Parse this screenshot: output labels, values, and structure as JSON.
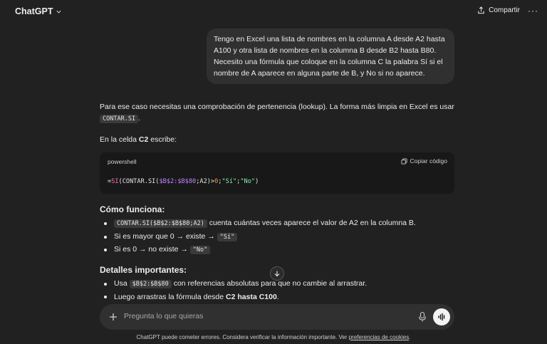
{
  "header": {
    "brand": "ChatGPT",
    "share_label": "Compartir",
    "more_label": "···"
  },
  "user_message": "Tengo en Excel una lista de nombres en la columna A desde A2 hasta A100 y otra lista de nombres en la columna B desde B2 hasta B80. Necesito una fórmula que coloque en la columna C la palabra Sí si el nombre de A aparece en alguna parte de B, y No si no aparece.",
  "answer": {
    "intro": "Para ese caso necesitas una comprobación de pertenencia (lookup). La forma más limpia en Excel es usar",
    "intro_code": "CONTAR.SI",
    "intro_end": ".",
    "cell_prefix": "En la celda ",
    "cell_bold": "C2",
    "cell_suffix": " escribe:",
    "code": {
      "lang": "powershell",
      "copy_label": "Copiar código",
      "t1": "=",
      "t2": "SI",
      "t3": "(CONTAR.SI(",
      "t4": "$B$2:$B$80",
      "t5": ";A2)>",
      "t6": "0",
      "t7": ";",
      "t8": "\"Sí\"",
      "t9": ";",
      "t10": "\"No\"",
      "t11": ")"
    },
    "how_title": "Cómo funciona:",
    "how_items": [
      {
        "code": "CONTAR.SI($B$2:$B$80;A2)",
        "text": " cuenta cuántas veces aparece el valor de A2 en la columna B."
      },
      {
        "text": "Si es mayor que 0 → existe → ",
        "code": "\"Sí\""
      },
      {
        "text": "Si es 0 → no existe → ",
        "code": "\"No\""
      }
    ],
    "details_title": "Detalles importantes:",
    "details_items": [
      {
        "pre": "Usa ",
        "code": "$B$2:$B$80",
        "text": " con referencias absolutas para que no cambie al arrastrar."
      },
      {
        "pre": "Luego arrastras la fórmula desde ",
        "bold": "C2 hasta C100",
        "text": "."
      }
    ]
  },
  "composer": {
    "placeholder": "Pregunta lo que quieras"
  },
  "footer": {
    "text": "ChatGPT puede cometer errores. Considera verificar la información importante. Ver ",
    "link": "preferencias de cookies",
    "end": "."
  },
  "colors": {
    "background": "#212121",
    "bubble": "#303030",
    "code_bg": "#181818"
  }
}
